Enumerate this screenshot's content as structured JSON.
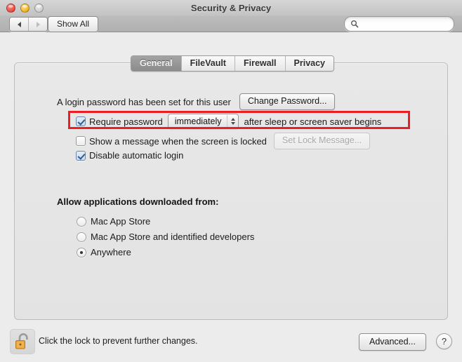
{
  "window": {
    "title": "Security & Privacy",
    "traffic_lights": [
      "close",
      "minimize",
      "zoom"
    ]
  },
  "toolbar": {
    "back_icon": "arrow-left-icon",
    "forward_icon": "arrow-right-icon",
    "show_all_label": "Show All",
    "search_icon": "search-icon",
    "search_value": "",
    "search_placeholder": ""
  },
  "tabs": [
    {
      "label": "General",
      "active": true
    },
    {
      "label": "FileVault",
      "active": false
    },
    {
      "label": "Firewall",
      "active": false
    },
    {
      "label": "Privacy",
      "active": false
    }
  ],
  "general": {
    "login_password_text": "A login password has been set for this user",
    "change_password_label": "Change Password...",
    "require_password": {
      "checked": true,
      "label_before": "Require password",
      "popup_value": "immediately",
      "label_after": "after sleep or screen saver begins"
    },
    "show_message": {
      "checked": false,
      "label": "Show a message when the screen is locked",
      "button_label": "Set Lock Message...",
      "button_disabled": true
    },
    "disable_auto_login": {
      "checked": true,
      "label": "Disable automatic login"
    },
    "allow_apps_label": "Allow applications downloaded from:",
    "allow_apps_options": [
      {
        "label": "Mac App Store",
        "selected": false
      },
      {
        "label": "Mac App Store and identified developers",
        "selected": false
      },
      {
        "label": "Anywhere",
        "selected": true
      }
    ]
  },
  "bottom": {
    "lock_icon": "unlocked-padlock-icon",
    "lock_text": "Click the lock to prevent further changes.",
    "advanced_label": "Advanced...",
    "help_label": "?"
  },
  "colors": {
    "highlight_border": "#ee1c25",
    "active_tab_bg": "#949494",
    "window_bg": "#ececec",
    "lock_body": "#e8a33d"
  }
}
